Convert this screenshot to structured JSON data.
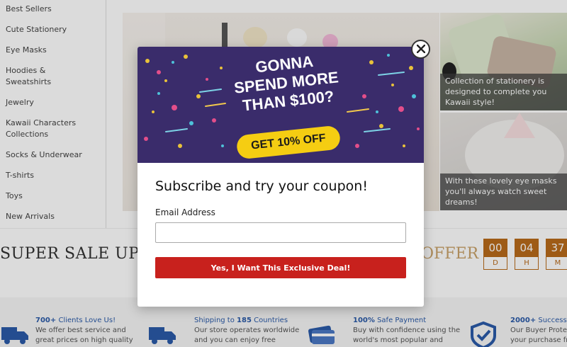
{
  "sidebar": {
    "items": [
      {
        "label": "Best Sellers"
      },
      {
        "label": "Cute Stationery"
      },
      {
        "label": "Eye Masks"
      },
      {
        "label": "Hoodies &\nSweatshirts"
      },
      {
        "label": "Jewelry"
      },
      {
        "label": "Kawaii Characters\nCollections"
      },
      {
        "label": "Socks & Underwear"
      },
      {
        "label": "T-shirts"
      },
      {
        "label": "Toys"
      },
      {
        "label": "New Arrivals"
      }
    ]
  },
  "side_banners": [
    {
      "caption": "Collection of stationery is designed to complete you Kawaii style!"
    },
    {
      "caption": "With these lovely eye masks you'll always watch sweet dreams!"
    }
  ],
  "sale": {
    "text": "SUPER SALE UP TO",
    "offer": "OFFER",
    "countdown": [
      {
        "value": "00",
        "unit": "D"
      },
      {
        "value": "04",
        "unit": "H"
      },
      {
        "value": "37",
        "unit": "M"
      }
    ]
  },
  "features": [
    {
      "title_bold": "700+",
      "title_rest": " Clients Love Us!",
      "line1": "We offer best service and",
      "line2": "great prices on high quality",
      "icon": "truck-icon"
    },
    {
      "title_pre": "Shipping to ",
      "title_bold": "185",
      "title_rest": " Countries",
      "line1": "Our store operates worldwide",
      "line2": "and you can enjoy free",
      "icon": "delivery-truck-icon"
    },
    {
      "title_bold": "100%",
      "title_rest": " Safe Payment",
      "line1": "Buy with confidence using the",
      "line2": "world's most popular and",
      "icon": "credit-card-icon"
    },
    {
      "title_bold": "2000+",
      "title_rest": " Successful",
      "line1": "Our Buyer Protec",
      "line2": "your purchase fr",
      "icon": "shield-check-icon"
    }
  ],
  "popup": {
    "banner_line1": "GONNA",
    "banner_line2": "SPEND MORE",
    "banner_line3": "THAN $100?",
    "banner_badge": "GET 10% OFF",
    "title": "Subscribe and try your coupon!",
    "email_label": "Email Address",
    "email_value": "",
    "email_placeholder": "",
    "submit_label": "Yes, I Want This Exclusive Deal!",
    "close_icon": "close-icon"
  },
  "colors": {
    "accent_red": "#c8211d",
    "countdown_brown": "#b86a1a",
    "banner_purple": "#3a2c6b",
    "badge_yellow": "#f5cd12"
  }
}
